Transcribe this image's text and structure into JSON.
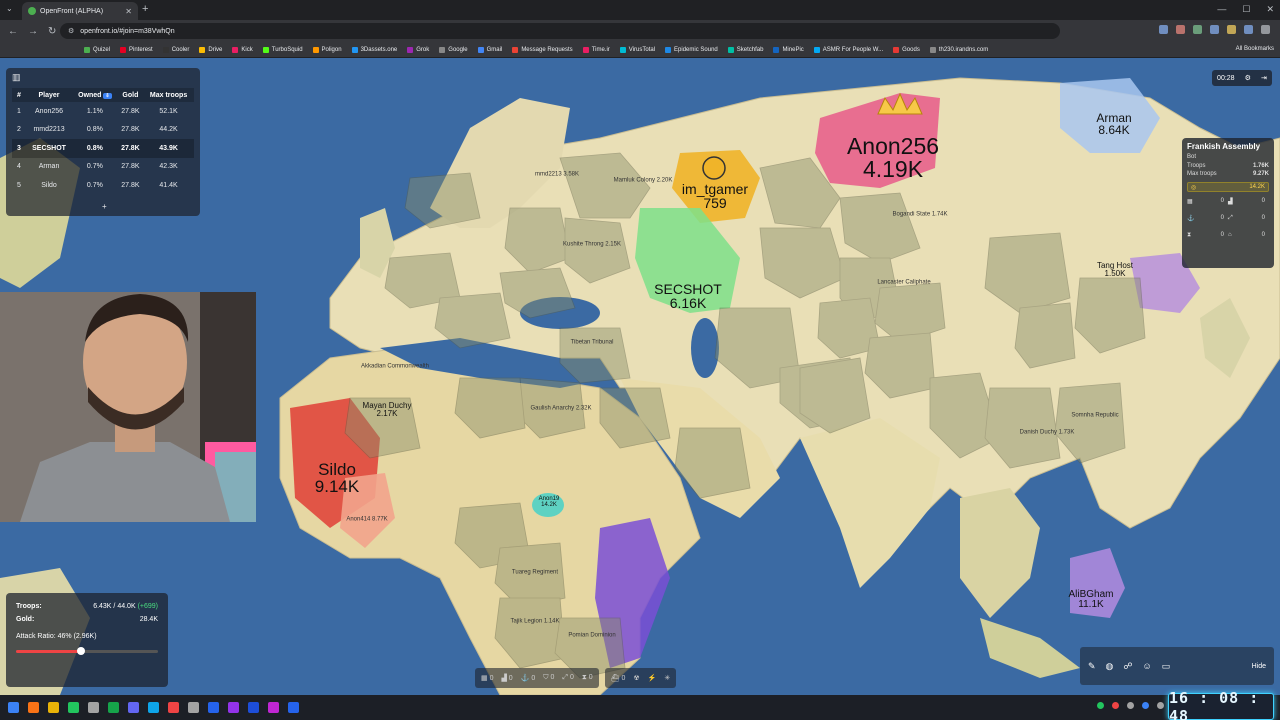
{
  "browser": {
    "tab_title": "OpenFront (ALPHA)",
    "url": "openfront.io/#join=m38VwhQn",
    "bookmarks": [
      "Quizel",
      "Pinterest",
      "Cooler",
      "Drive",
      "Kick",
      "TurboSquid",
      "Poligon",
      "3Dassets.one",
      "Grok",
      "Google",
      "Gmail",
      "Message Requests",
      "Time.ir",
      "VirusTotal",
      "Epidemic Sound",
      "Sketchfab",
      "MinePic",
      "ASMR For People W...",
      "Goods",
      "th230.irandns.com"
    ],
    "all_bookmarks": "All Bookmarks"
  },
  "leaderboard": {
    "columns": [
      "#",
      "Player",
      "Owned",
      "Gold",
      "Max troops"
    ],
    "sort_badge": "⇩",
    "rows": [
      {
        "rank": "1",
        "player": "Anon256",
        "owned": "1.1%",
        "gold": "27.8K",
        "max_troops": "52.1K"
      },
      {
        "rank": "2",
        "player": "mmd2213",
        "owned": "0.8%",
        "gold": "27.8K",
        "max_troops": "44.2K"
      },
      {
        "rank": "3",
        "player": "SECSHOT",
        "owned": "0.8%",
        "gold": "27.8K",
        "max_troops": "43.9K"
      },
      {
        "rank": "4",
        "player": "Arman",
        "owned": "0.7%",
        "gold": "27.8K",
        "max_troops": "42.3K"
      },
      {
        "rank": "5",
        "player": "Sildo",
        "owned": "0.7%",
        "gold": "27.8K",
        "max_troops": "41.4K"
      }
    ],
    "expand": "+"
  },
  "timer": "00:28",
  "info_panel": {
    "title": "Frankish Assembly",
    "type": "Bot",
    "troops_label": "Troops",
    "troops": "1.76K",
    "max_troops_label": "Max troops",
    "max_troops": "9.27K",
    "gold": "14.2K",
    "counts": [
      "0",
      "0",
      "0",
      "0",
      "0",
      "0"
    ]
  },
  "big_players": [
    {
      "name": "Anon256",
      "value": "4.19K"
    },
    {
      "name": "im_tgamer",
      "value": "759"
    },
    {
      "name": "SECSHOT",
      "value": "6.16K"
    },
    {
      "name": "Sildo",
      "value": "9.14K"
    },
    {
      "name": "Arman",
      "value": "8.64K"
    },
    {
      "name": "AliBGham",
      "value": "11.1K"
    },
    {
      "name": "Tang Host",
      "value": "1.50K"
    },
    {
      "name": "Mayan Duchy",
      "value": "2.17K"
    },
    {
      "name": "Anon19",
      "value": "14.2K"
    }
  ],
  "small_labels": [
    "Mamluk Colony 2.20K",
    "Kushite Throng 2.15K",
    "Mayan Duchy 2.17K",
    "Gaulish Anarchy 2.32K",
    "Akkadian Commonwealth",
    "Tajik Legion 1.14K",
    "Bogandi State 1.74K",
    "Lancaster Caliphate",
    "Tibetan Tribunal",
    "Somnha Republic",
    "Danish Duchy 1.73K",
    "Tuareg Regiment",
    "Pomian Dominion",
    "mmd2213 3.58K",
    "Anon414 8.77K"
  ],
  "stats": {
    "troops_label": "Troops:",
    "troops": "6.43K / 44.0K",
    "troops_gain": "(+699)",
    "gold_label": "Gold:",
    "gold": "28.4K",
    "attack_ratio": "Attack Ratio: 46% (2.96K)",
    "attack_ratio_value": 0.46
  },
  "build_bar": [
    "0",
    "0",
    "0",
    "0",
    "0",
    "0",
    "0",
    "0",
    "0",
    "0"
  ],
  "emoji_bar": {
    "hide": "Hide"
  },
  "clock": "16 : 08 : 48"
}
